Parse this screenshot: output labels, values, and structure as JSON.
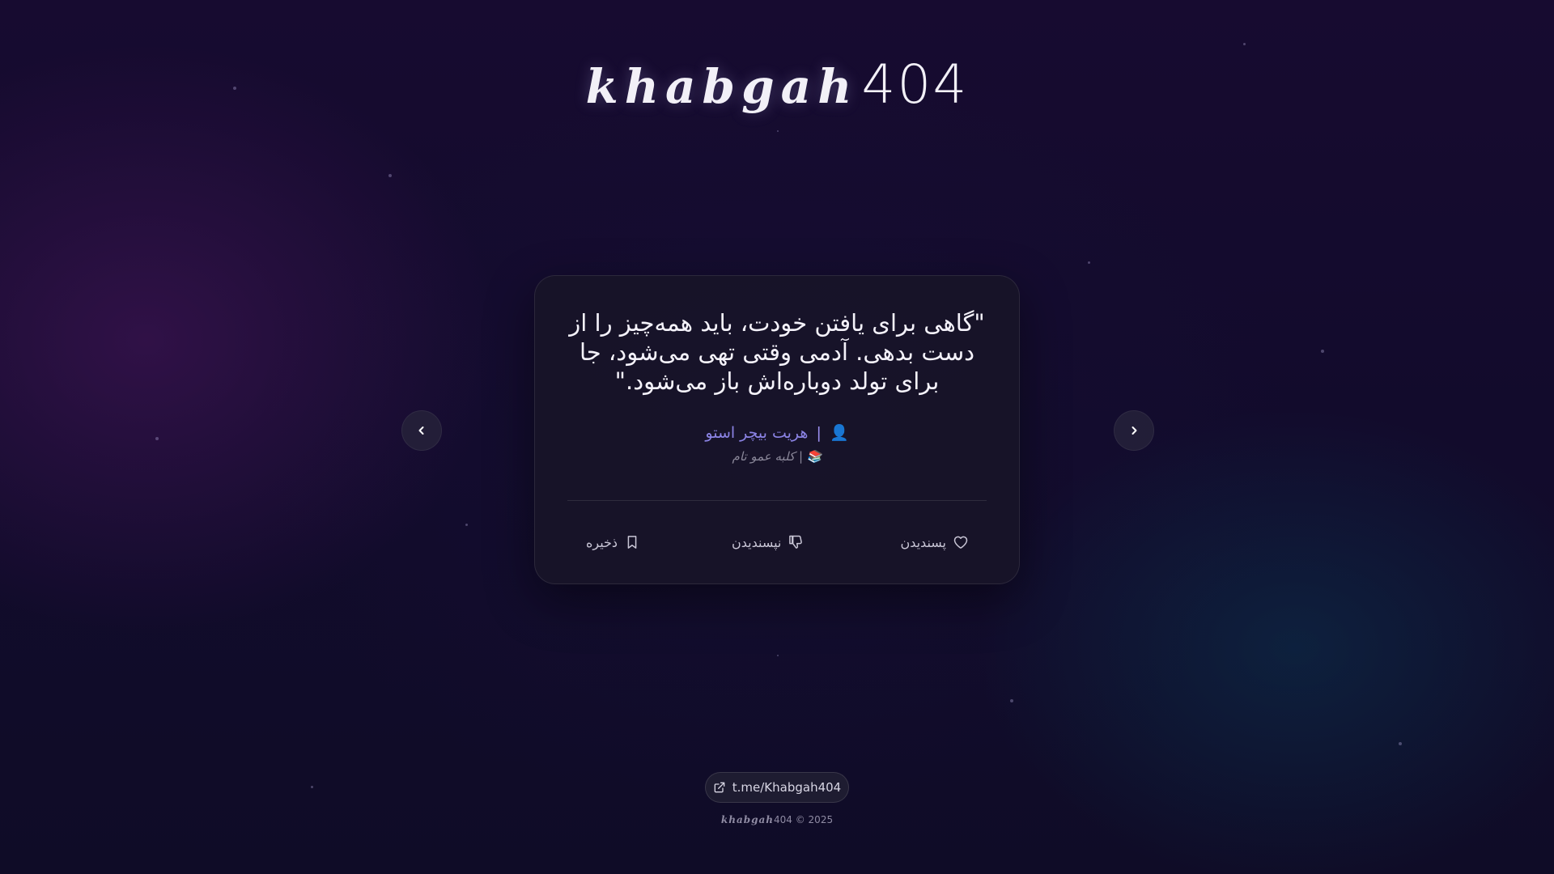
{
  "brand": {
    "logo_word": "khabgah",
    "logo_number": "404"
  },
  "quote": {
    "text": "\"گاهی برای یافتن خودت، باید همه‌چیز را از دست بدهی. آدمی وقتی تهی می‌شود، جا برای تولد دوباره‌اش باز می‌شود.\"",
    "author_icon": "👤",
    "author_separator": "|",
    "author": "هریت بیچر استو",
    "source_icon": "📚",
    "source_separator": "|",
    "source": "کلبه عمو تام"
  },
  "actions": {
    "like_label": "پسندیدن",
    "dislike_label": "نپسندیدن",
    "save_label": "ذخیره"
  },
  "navigation": {
    "prev_symbol": "‹",
    "next_symbol": "›"
  },
  "footer": {
    "telegram_link": "t.me/Khabgah404",
    "copyright_word": "khabgah",
    "copyright_number": "404",
    "copyright_suffix": " © 2025"
  },
  "colors": {
    "accent": "#8c84e6",
    "background": "#110a26",
    "card": "#181428"
  }
}
